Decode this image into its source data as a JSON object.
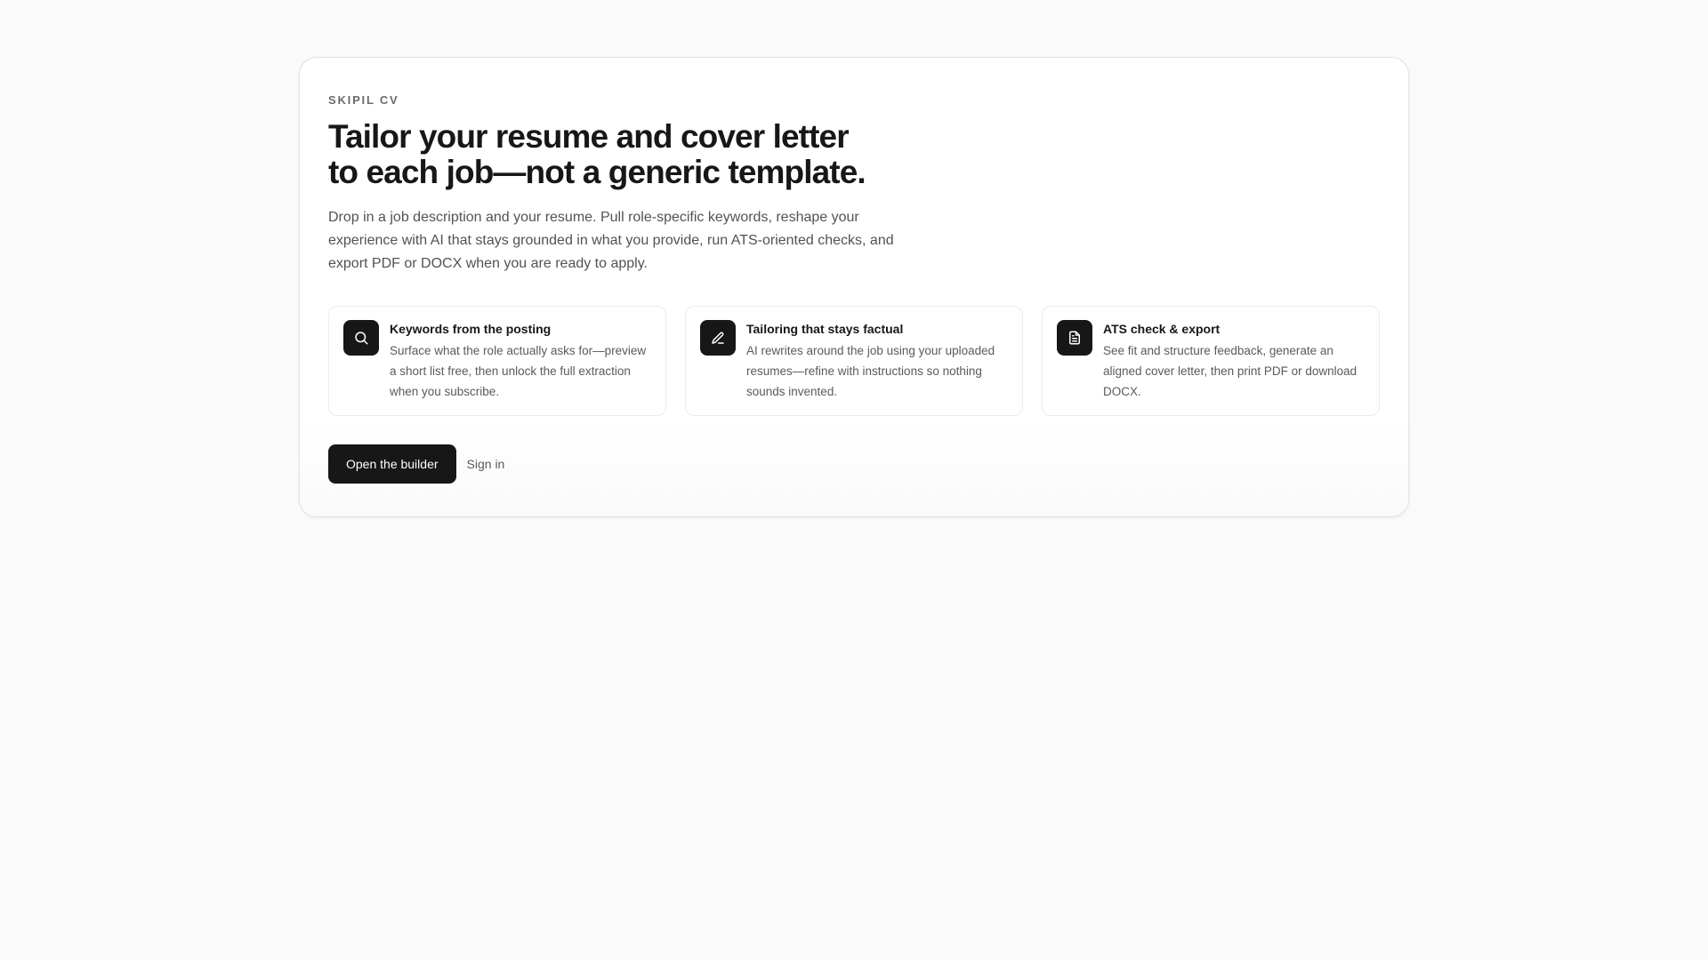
{
  "hero": {
    "eyebrow": "SKIPIL CV",
    "headline_line1": "Tailor your resume and cover letter",
    "headline_line2": "to each job—not a generic template.",
    "lede": "Drop in a job description and your resume. Pull role-specific keywords, reshape your experience with AI that stays grounded in what you provide, run ATS-oriented checks, and export PDF or DOCX when you are ready to apply."
  },
  "features": [
    {
      "icon": "search-icon",
      "title": "Keywords from the posting",
      "description": "Surface what the role actually asks for—preview a short list free, then unlock the full extraction when you subscribe."
    },
    {
      "icon": "pencil-icon",
      "title": "Tailoring that stays factual",
      "description": "AI rewrites around the job using your uploaded resumes—refine with instructions so nothing sounds invented."
    },
    {
      "icon": "document-icon",
      "title": "ATS check & export",
      "description": "See fit and structure feedback, generate an aligned cover letter, then print PDF or download DOCX."
    }
  ],
  "actions": {
    "primary_label": "Open the builder",
    "secondary_label": "Sign in"
  },
  "colors": {
    "background": "#fafafa",
    "card": "#ffffff",
    "primary": "#171717",
    "muted_text": "#525252"
  }
}
